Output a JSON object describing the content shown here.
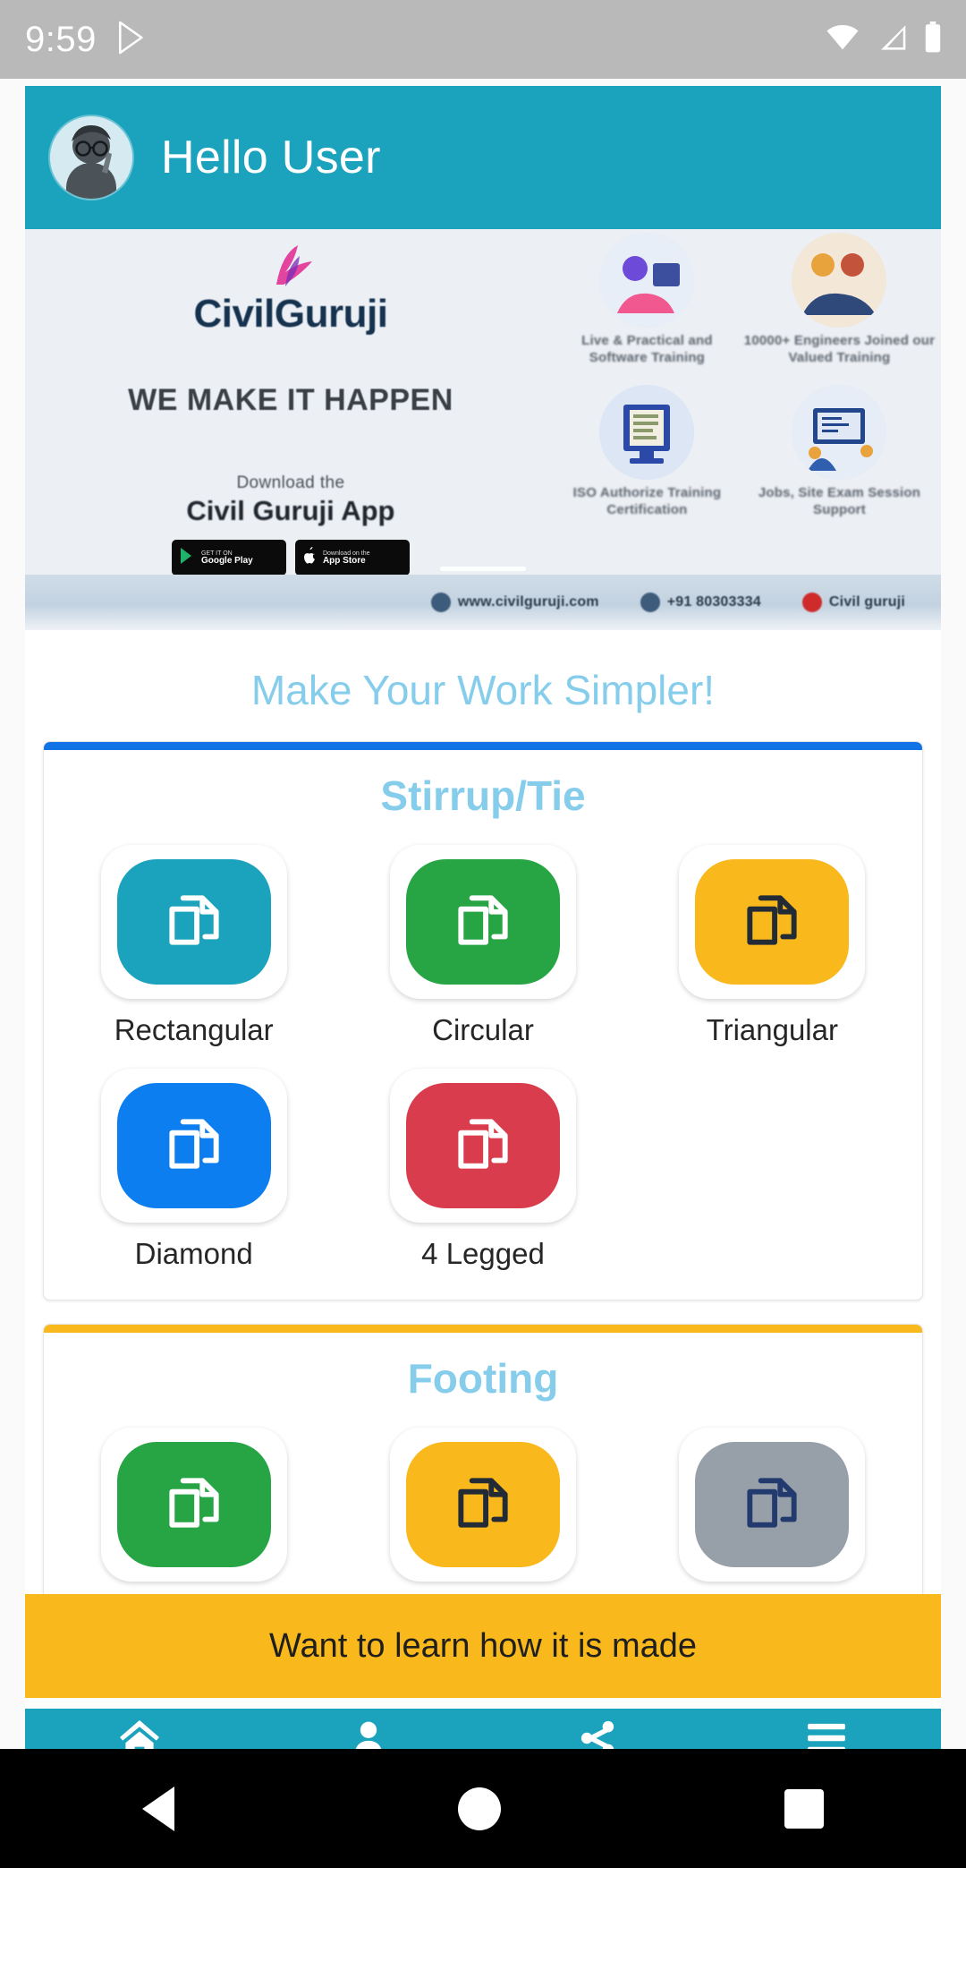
{
  "status_bar": {
    "time": "9:59",
    "icons": [
      "play-store-icon",
      "wifi-icon",
      "signal-icon",
      "battery-icon"
    ]
  },
  "header": {
    "greeting": "Hello User",
    "avatar_name": "user-avatar",
    "background_color": "#1ba3bd"
  },
  "banner": {
    "brand": "CivilGuruji",
    "tagline": "WE MAKE IT HAPPEN",
    "download_small": "Download the",
    "download_big": "Civil Guruji App",
    "badges": [
      {
        "top": "GET IT ON",
        "bottom": "Google Play",
        "icon": "google-play-icon"
      },
      {
        "top": "Download on the",
        "bottom": "App Store",
        "icon": "apple-icon"
      }
    ],
    "features": [
      "Live & Practical and Software Training",
      "10000+ Engineers Joined our Valued Training",
      "ISO Authorize Training Certification",
      "Jobs, Site Exam Session Support"
    ],
    "footer_items": [
      {
        "icon": "globe-icon",
        "text": "www.civilguruji.com"
      },
      {
        "icon": "phone-icon",
        "text": "+91 80303334"
      },
      {
        "icon": "youtube-icon",
        "text": "Civil guruji"
      }
    ]
  },
  "tagline": "Make Your Work Simpler!",
  "sections": [
    {
      "title": "Stirrup/Tie",
      "accent_color": "#1273e6",
      "tiles": [
        {
          "label": "Rectangular",
          "color": "#1ba3bd",
          "icon": "copy-documents-icon",
          "icon_color": "#ffffff"
        },
        {
          "label": "Circular",
          "color": "#27a544",
          "icon": "copy-documents-icon",
          "icon_color": "#ffffff"
        },
        {
          "label": "Triangular",
          "color": "#f9b81b",
          "icon": "copy-documents-icon",
          "icon_color": "#222b36"
        },
        {
          "label": "Diamond",
          "color": "#0d7ef0",
          "icon": "copy-documents-icon",
          "icon_color": "#ffffff"
        },
        {
          "label": "4 Legged",
          "color": "#d93c4c",
          "icon": "copy-documents-icon",
          "icon_color": "#ffffff"
        }
      ]
    },
    {
      "title": "Footing",
      "accent_color": "#f9b81b",
      "tiles": [
        {
          "label": "",
          "color": "#27a544",
          "icon": "copy-documents-icon",
          "icon_color": "#ffffff"
        },
        {
          "label": "",
          "color": "#f9b81b",
          "icon": "copy-documents-icon",
          "icon_color": "#222b36"
        },
        {
          "label": "",
          "color": "#97a0a8",
          "icon": "copy-documents-icon",
          "icon_color": "#ffffff"
        }
      ]
    }
  ],
  "cta": {
    "label": "Want to learn how it is made",
    "background_color": "#f9b81b"
  },
  "bottom_nav": {
    "background_color": "#1ba3bd",
    "items": [
      {
        "label": "Home",
        "icon": "home-icon"
      },
      {
        "label": "Profile",
        "icon": "person-icon"
      },
      {
        "label": "Share",
        "icon": "share-icon"
      },
      {
        "label": "Menu",
        "icon": "hamburger-menu-icon"
      }
    ]
  },
  "system_nav": {
    "back": "back-triangle-icon",
    "home": "home-circle-icon",
    "recents": "recents-square-icon"
  }
}
